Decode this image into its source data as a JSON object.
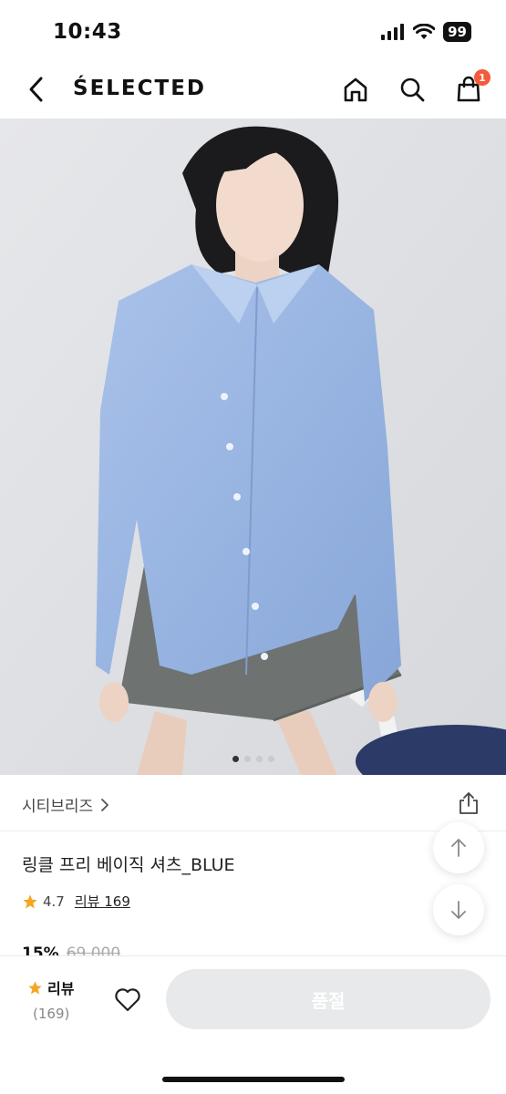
{
  "status_bar": {
    "time": "10:43",
    "battery": "99"
  },
  "nav": {
    "brand": "ŚELECTED",
    "cart_count": "1"
  },
  "gallery": {
    "total_images": 4,
    "active_index": 0
  },
  "product": {
    "brand_name": "시티브리즈",
    "name": "링클 프리 베이직 셔츠_BLUE",
    "rating": "4.7",
    "review_label": "리뷰 169",
    "discount": "15%",
    "original_price": "69,000"
  },
  "bottom_bar": {
    "review_label": "리뷰",
    "review_count": "(169)",
    "soldout_label": "품절"
  },
  "colors": {
    "accent_badge": "#f35b3b",
    "star": "#f5a623",
    "shirt": "#9ab5e3",
    "skirt": "#6e7372",
    "soldout_bg": "#e8e9eb"
  }
}
